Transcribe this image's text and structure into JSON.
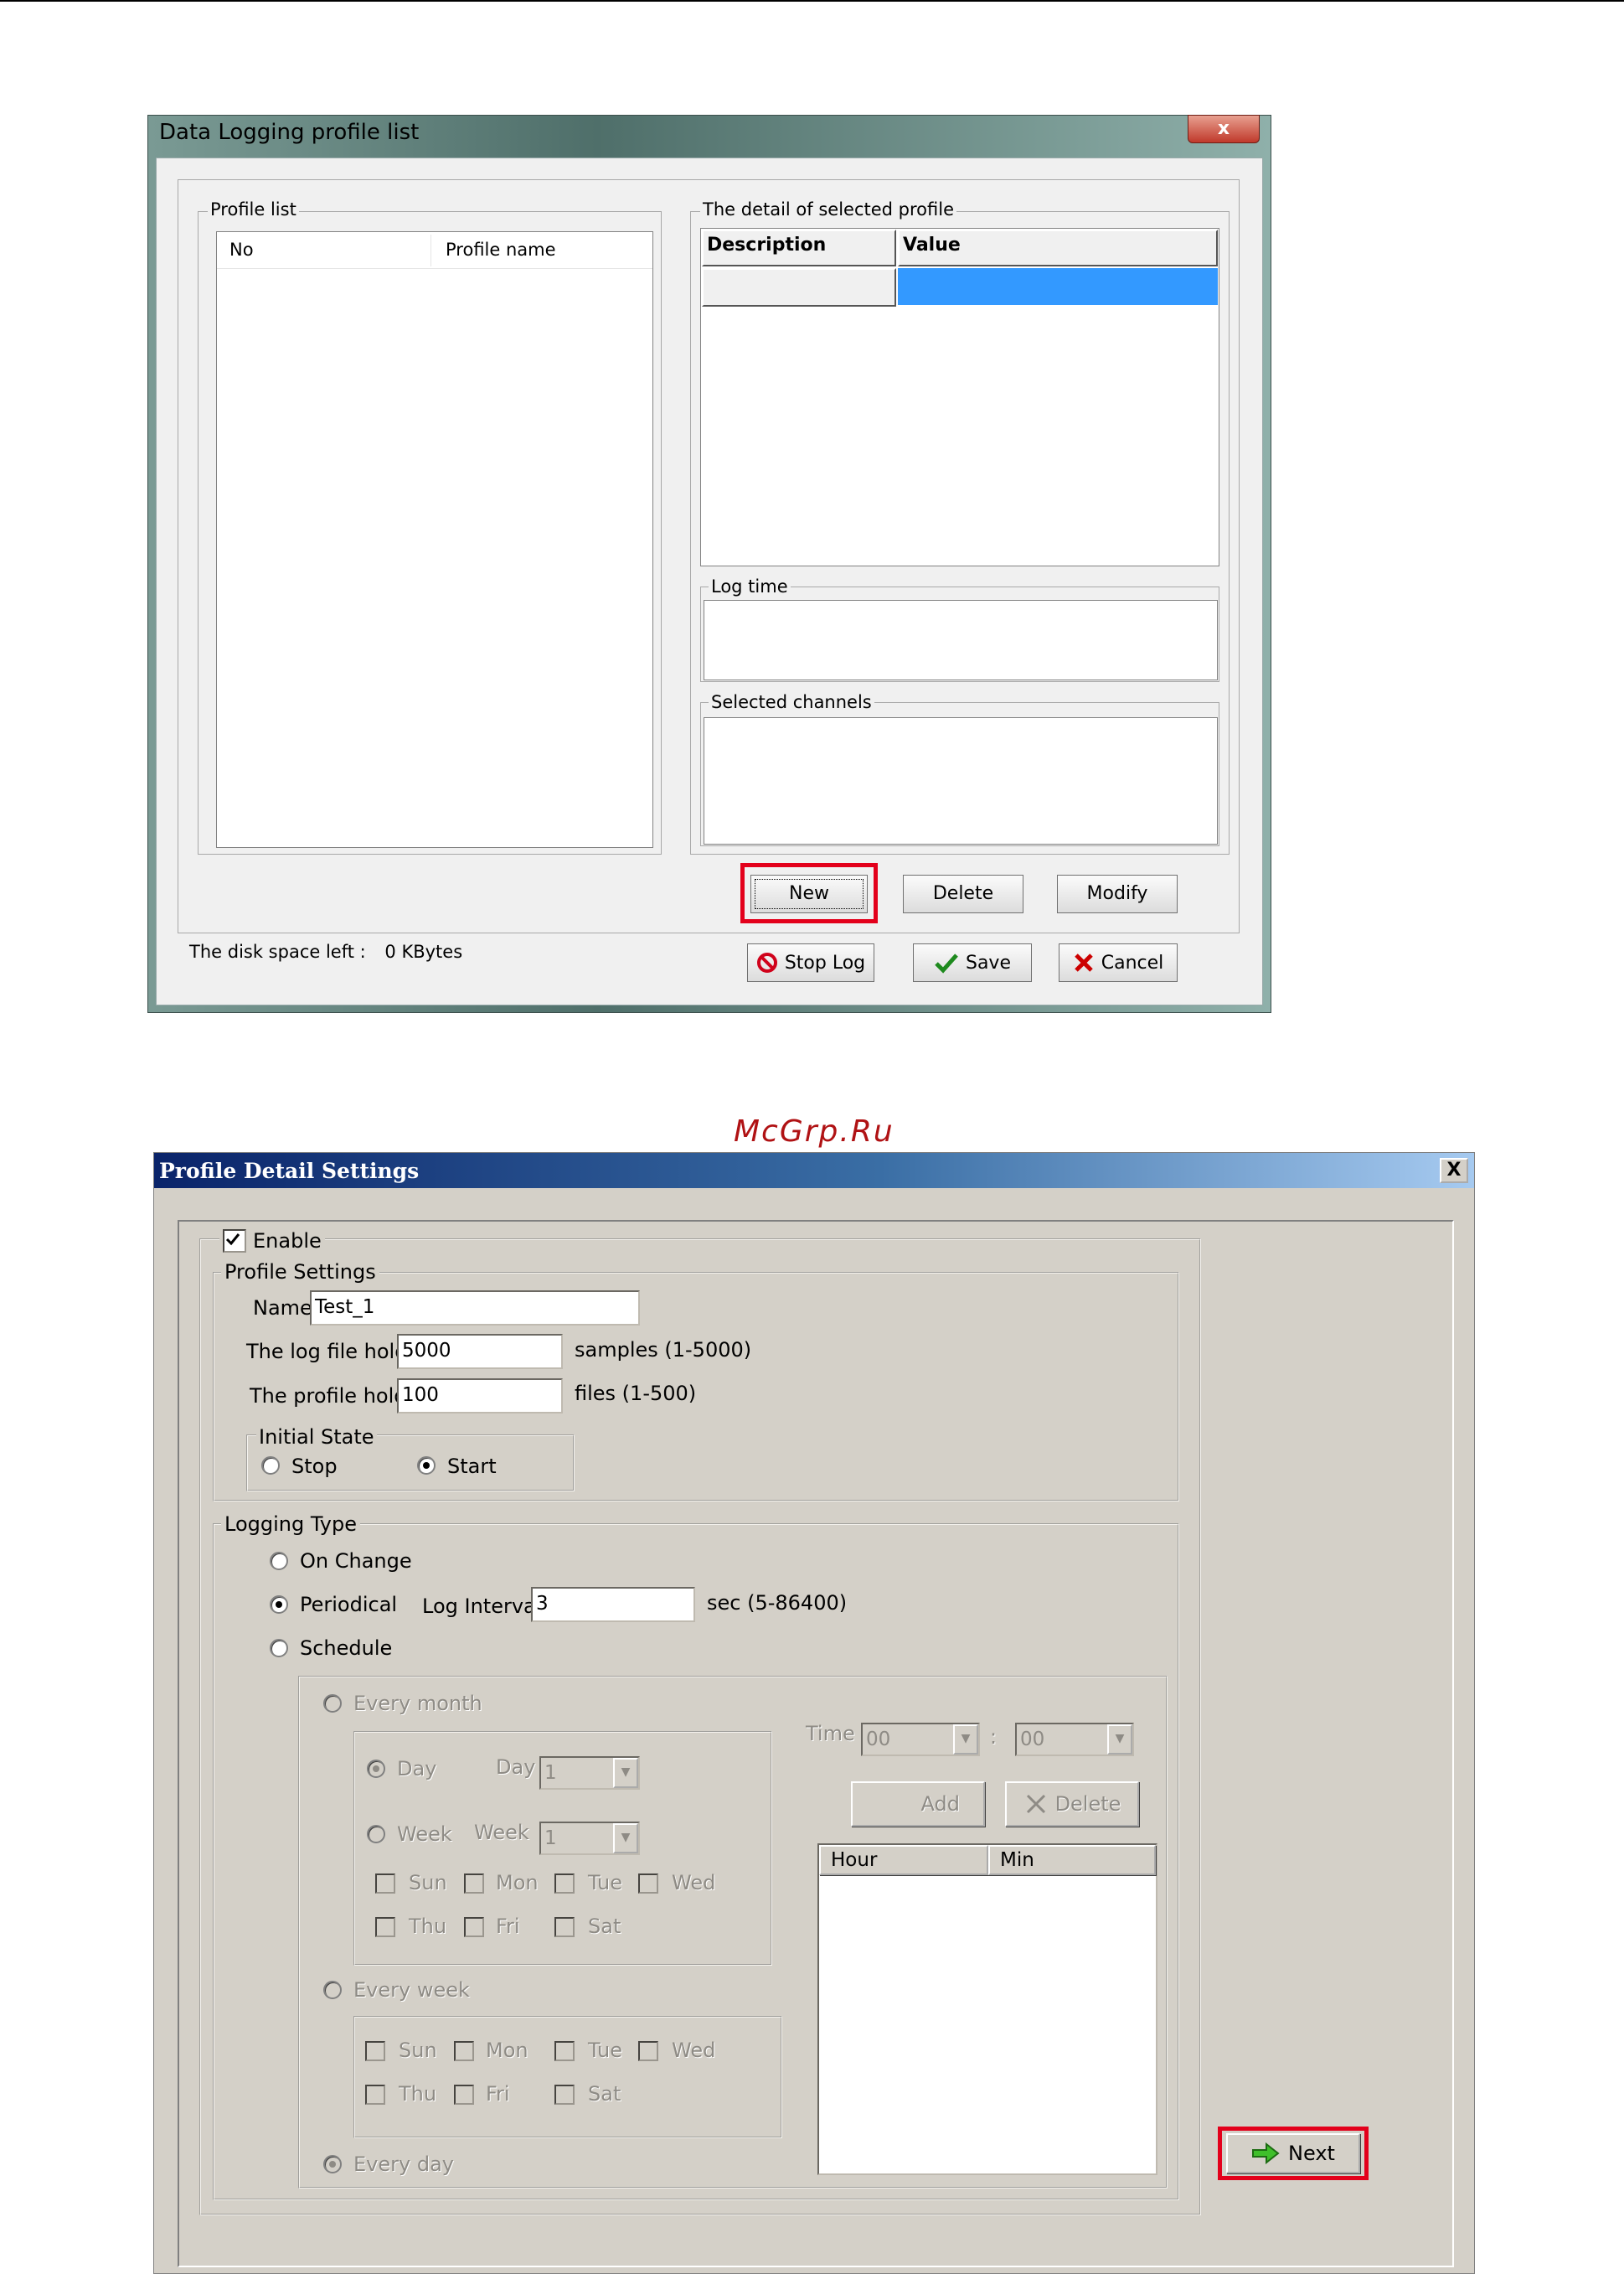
{
  "dialog1": {
    "title": "Data Logging profile list",
    "close_glyph": "x",
    "profile_list": {
      "label": "Profile list",
      "columns": [
        "No",
        "Profile name"
      ]
    },
    "detail": {
      "label": "The detail of selected profile",
      "columns": [
        "Description",
        "Value"
      ]
    },
    "log_time_label": "Log time",
    "selected_channels_label": "Selected channels",
    "buttons": {
      "new": "New",
      "delete": "Delete",
      "modify": "Modify",
      "stop_log": "Stop Log",
      "save": "Save",
      "cancel": "Cancel"
    },
    "disk_space_label": "The disk space left :",
    "disk_space_value": "0 KBytes"
  },
  "watermark": "McGrp.Ru",
  "dialog2": {
    "title": "Profile Detail Settings",
    "close_glyph": "X",
    "enable": {
      "label": "Enable",
      "checked": true
    },
    "profile_settings": {
      "label": "Profile Settings",
      "name_label": "Name",
      "name_value": "Test_1",
      "log_file_label": "The log file holds",
      "log_file_value": "5000",
      "log_file_unit": "samples (1-5000)",
      "profile_holds_label": "The profile holds",
      "profile_holds_value": "100",
      "profile_holds_unit": "files (1-500)",
      "initial_state": {
        "label": "Initial State",
        "stop": "Stop",
        "start": "Start",
        "selected": "Start"
      }
    },
    "logging_type": {
      "label": "Logging Type",
      "on_change": "On Change",
      "periodical": "Periodical",
      "schedule": "Schedule",
      "selected": "Periodical",
      "log_interval_label": "Log Interval",
      "log_interval_value": "3",
      "log_interval_unit": "sec (5-86400)"
    },
    "schedule": {
      "every_month": "Every month",
      "day_option": "Day",
      "day_label": "Day",
      "day_value": "1",
      "week_option": "Week",
      "week_label": "Week",
      "week_value": "1",
      "days_row1": [
        "Sun",
        "Mon",
        "Tue",
        "Wed"
      ],
      "days_row2": [
        "Thu",
        "Fri",
        "Sat"
      ],
      "every_week": "Every week",
      "every_day": "Every day",
      "time_label": "Time",
      "hour_value": "00",
      "min_value": "00",
      "time_sep": ":",
      "add": "Add",
      "delete": "Delete",
      "columns": [
        "Hour",
        "Min"
      ]
    },
    "next": "Next"
  }
}
